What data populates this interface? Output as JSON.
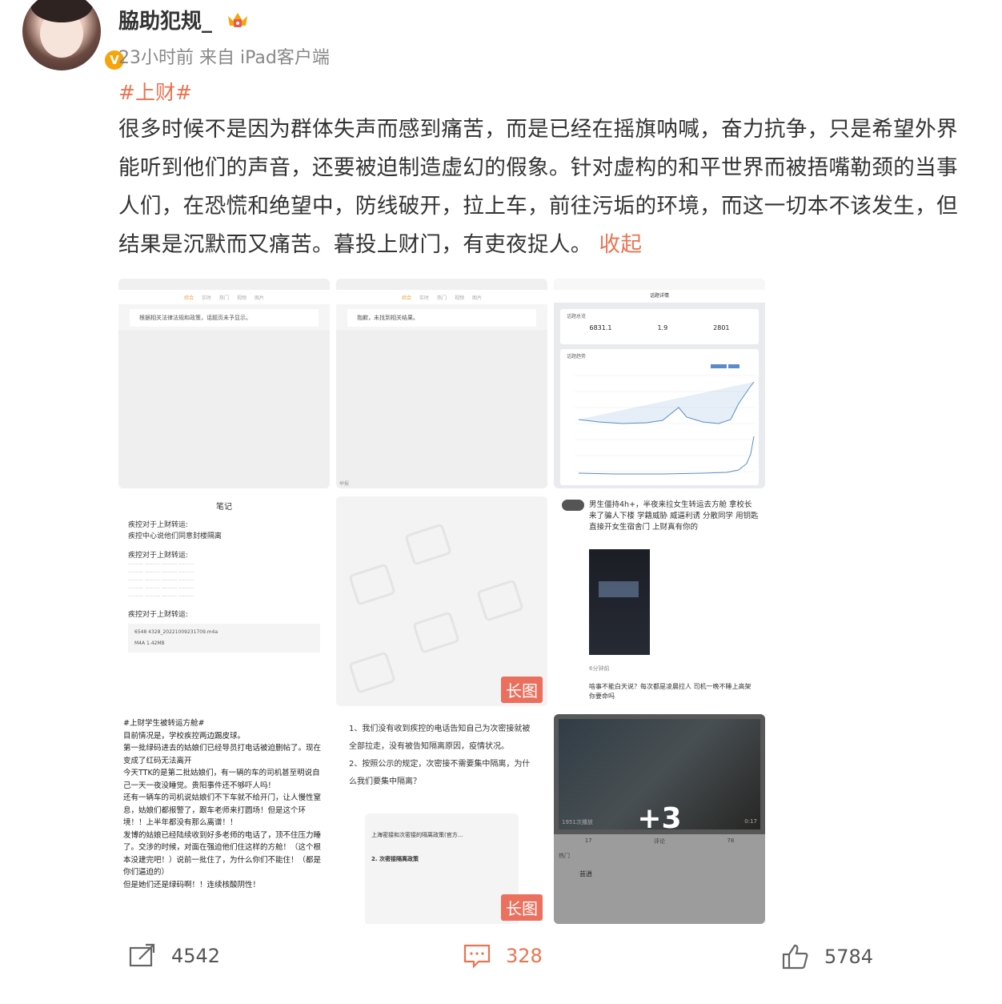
{
  "post": {
    "username": "脇助犯规_",
    "meta": "23小时前  来自 iPad客户端",
    "verified_badge": "V",
    "topic": "#上财#",
    "body": "很多时候不是因为群体失声而感到痛苦，而是已经在摇旗呐喊，奋力抗争，只是希望外界能听到他们的声音，还要被迫制造虚幻的假象。针对虚构的和平世界而被捂嘴勒颈的当事人们，在恐慌和绝望中，防线破开，拉上车，前往污垢的环境，而这一切本不该发生，但结果是沉默而又痛苦。暮投上财门，有吏夜捉人。",
    "collapse_label": "收起",
    "accent": "#eb7350"
  },
  "images": {
    "img1": {
      "tabs": [
        "综合",
        "实时",
        "热门",
        "视频",
        "图片"
      ],
      "message": "根据相关法律法规和政策，话题页未予显示。"
    },
    "img2": {
      "tabs": [
        "综合",
        "实时",
        "热门",
        "视频",
        "图片"
      ],
      "message": "抱歉，未找到相关结果。",
      "bottom_hint": "举报"
    },
    "img3": {
      "header": "话题详情",
      "sec1": "话题总览",
      "stat1": "6831.1",
      "stat2": "1.9",
      "stat3": "2801",
      "sec2": "话题趋势"
    },
    "img4": {
      "title": "笔记",
      "line1": "疾控对于上财转运:",
      "line2": "疾控中心说他们同意封楼隔离",
      "line3": "疾控对于上财转运:",
      "line4": "疾控对于上财转运:",
      "file": "6548 4328_20221009231709.m4a",
      "file_size": "M4A 1.42MB"
    },
    "img5": {
      "badge": "长图"
    },
    "img6": {
      "text": "男生僵持4h+，半夜来拉女生转运去方舱 拿校长来了骗人下楼 学籍威胁 威逼利诱 分散同学  用钥匙直接开女生宿舍门 上财真有你的",
      "time": "6分钟前",
      "comment": "啥事不能白天说？每次都是凌晨拉人 司机一晚不睡上高架 你要命吗"
    },
    "img7": {
      "header": "#上财学生被转运方舱#",
      "text": "目前情况是，学校疾控两边踢皮球。\n第一批绿码进去的姑娘们已经导员打电话被迫删帖了。现在变成了红码无法离开\n今天TTK的是第二批姑娘们，有一辆的车的司机甚至明说自己一天一夜没睡觉。贵阳事件还不够吓人吗！\n还有一辆车的司机说姑娘们不下车就不给开门，让人慢性窒息，姑娘们都报警了，跟车老师来打圆场！但是这个环境！！上半年都没有那么离谱！！\n发博的姑娘已经陆续收到好多老师的电话了，顶不住压力睡了。交涉的时候，对面在强迫他们住这样的方舱！（这个根本没建完吧！）说前一批住了，为什么你们不能住！（都是你们逼迫的）\n但是她们还是绿码啊！！连续核酸阴性！"
    },
    "img8": {
      "text1": "1、我们没有收到疾控的电话告知自己为次密接就被全部拉走，没有被告知隔离原因，疫情状况。",
      "text2": "2、按照公示的规定，次密接不需要集中隔离，为什么我们要集中隔离？",
      "inner_title": "上海密接和次密接的隔离政策(官方...",
      "inner_sub": "2. 次密接隔离政策",
      "badge": "长图"
    },
    "img9": {
      "views": "1951次播放",
      "duration": "0:17",
      "plus": "+3",
      "label_hot": "热门",
      "commenter": "芸逍",
      "stat1": "17",
      "stat2": "评论",
      "stat3": "78"
    }
  },
  "footer": {
    "repost_count": "4542",
    "comment_count": "328",
    "like_count": "5784"
  }
}
